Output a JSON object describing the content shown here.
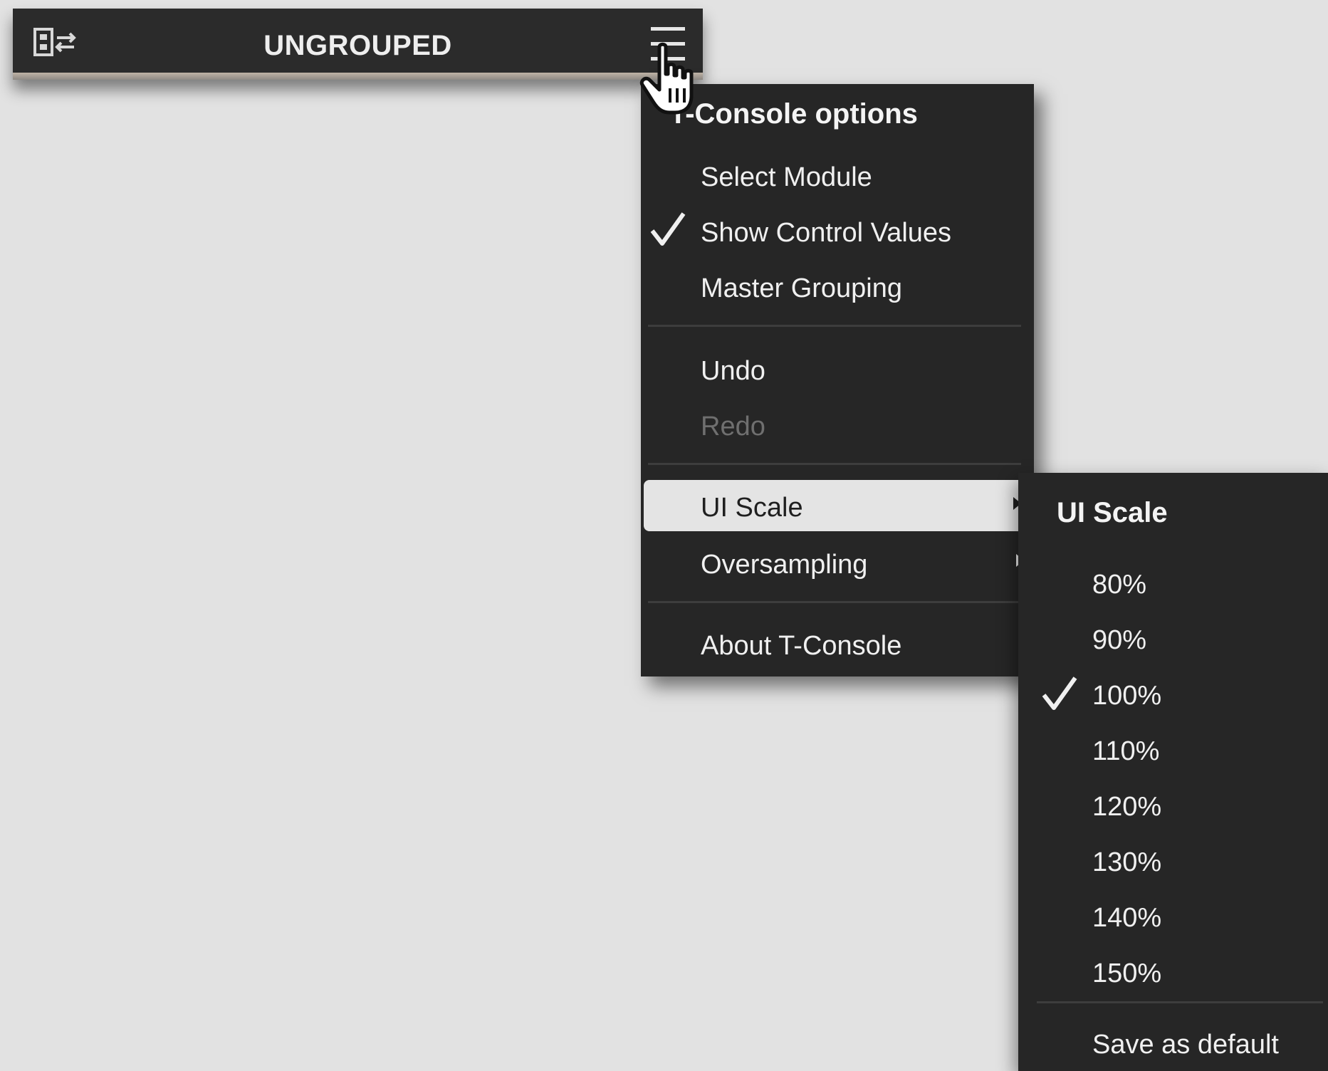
{
  "header": {
    "title": "UNGROUPED",
    "left_icon": "module-selector-icon",
    "menu_icon": "hamburger-menu-icon"
  },
  "main_menu": {
    "heading": "T-Console options",
    "items": [
      {
        "label": "Select Module",
        "checked": false,
        "enabled": true
      },
      {
        "label": "Show Control Values",
        "checked": true,
        "enabled": true
      },
      {
        "label": "Master Grouping",
        "checked": false,
        "enabled": true
      },
      {
        "label": "Undo",
        "checked": false,
        "enabled": true
      },
      {
        "label": "Redo",
        "checked": false,
        "enabled": false
      },
      {
        "label": "UI Scale",
        "submenu": true,
        "highlighted": true,
        "enabled": true
      },
      {
        "label": "Oversampling",
        "submenu": true,
        "enabled": true
      },
      {
        "label": "About T-Console",
        "checked": false,
        "enabled": true
      }
    ]
  },
  "scale_menu": {
    "heading": "UI Scale",
    "options": [
      "80%",
      "90%",
      "100%",
      "110%",
      "120%",
      "130%",
      "140%",
      "150%"
    ],
    "selected": "100%",
    "save_label": "Save as default"
  },
  "cursor": "hand-pointer-icon",
  "colors": {
    "background": "#e2e2e2",
    "menu_background": "#262626",
    "header_background": "#2b2b2b",
    "highlight": "#e4e4e4",
    "text": "#f0f0f0",
    "disabled_text": "#6f6f6f"
  }
}
